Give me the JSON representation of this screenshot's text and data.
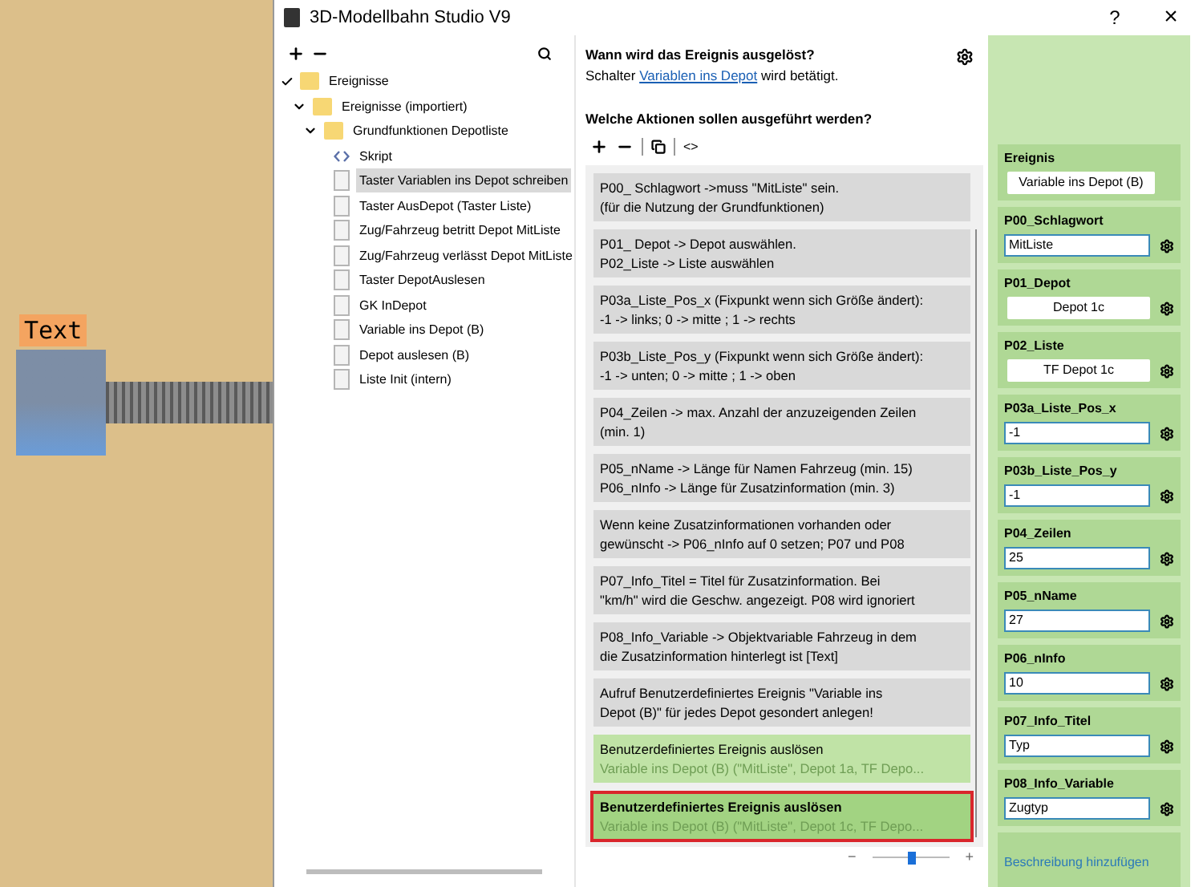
{
  "canvas": {
    "label": "Text"
  },
  "window": {
    "title": "3D-Modellbahn Studio V9",
    "help": "?",
    "close": "×"
  },
  "tree": {
    "items": [
      {
        "label": "Ereignisse",
        "kind": "folder",
        "expanded": true,
        "selected": false,
        "children": [
          {
            "label": "Ereignisse (importiert)",
            "kind": "folder",
            "expanded": true,
            "selected": false,
            "children": [
              {
                "label": "Grundfunktionen Depotliste",
                "kind": "folder",
                "expanded": true,
                "selected": false,
                "children": [
                  {
                    "label": "Skript",
                    "kind": "script",
                    "selected": false
                  },
                  {
                    "label": "Taster Variablen ins Depot schreiben",
                    "kind": "page",
                    "selected": true
                  },
                  {
                    "label": "Taster AusDepot (Taster Liste)",
                    "kind": "page",
                    "selected": false
                  },
                  {
                    "label": "Zug/Fahrzeug betritt Depot MitListe",
                    "kind": "page",
                    "selected": false
                  },
                  {
                    "label": "Zug/Fahrzeug verlässt Depot MitListe",
                    "kind": "page",
                    "selected": false
                  },
                  {
                    "label": "Taster DepotAuslesen",
                    "kind": "page",
                    "selected": false
                  },
                  {
                    "label": "GK InDepot",
                    "kind": "page",
                    "selected": false
                  },
                  {
                    "label": "Variable ins Depot (B)",
                    "kind": "page",
                    "selected": false
                  },
                  {
                    "label": "Depot auslesen (B)",
                    "kind": "page",
                    "selected": false
                  },
                  {
                    "label": "Liste Init (intern)",
                    "kind": "page",
                    "selected": false
                  }
                ]
              }
            ]
          }
        ]
      }
    ]
  },
  "trigger": {
    "heading": "Wann wird das Ereignis ausgelöst?",
    "text_before": "Schalter",
    "link": "Variablen ins Depot",
    "text_after": "wird betätigt."
  },
  "actions_heading": "Welche Aktionen sollen ausgeführt werden?",
  "toolbar": {
    "code": "<>"
  },
  "actions": [
    {
      "kind": "comment",
      "lines": [
        "P00_ Schlagwort ->muss \"MitListe\" sein.",
        "(für die Nutzung der Grundfunktionen)"
      ]
    },
    {
      "kind": "comment",
      "lines": [
        "P01_ Depot -> Depot auswählen.",
        "P02_Liste -> Liste auswählen"
      ]
    },
    {
      "kind": "comment",
      "lines": [
        "P03a_Liste_Pos_x (Fixpunkt wenn sich Größe ändert):",
        "-1 -> links;  0 -> mitte ; 1 -> rechts"
      ]
    },
    {
      "kind": "comment",
      "lines": [
        "P03b_Liste_Pos_y (Fixpunkt wenn sich Größe ändert):",
        "-1 -> unten;  0 -> mitte ; 1 -> oben"
      ]
    },
    {
      "kind": "comment",
      "lines": [
        "P04_Zeilen -> max. Anzahl der anzuzeigenden Zeilen",
        "(min. 1)"
      ]
    },
    {
      "kind": "comment",
      "lines": [
        "P05_nName -> Länge für Namen Fahrzeug (min. 15)",
        "P06_nInfo -> Länge für Zusatzinformation (min. 3)"
      ]
    },
    {
      "kind": "comment",
      "lines": [
        "Wenn keine Zusatzinformationen vorhanden oder",
        "gewünscht -> P06_nInfo auf 0 setzen; P07 und P08"
      ]
    },
    {
      "kind": "comment",
      "lines": [
        "P07_Info_Titel = Titel für Zusatzinformation. Bei",
        "\"km/h\" wird die Geschw. angezeigt. P08 wird ignoriert"
      ]
    },
    {
      "kind": "comment",
      "lines": [
        "P08_Info_Variable  -> Objektvariable Fahrzeug in dem",
        "die Zusatzinformation hinterlegt ist [Text]"
      ]
    },
    {
      "kind": "comment",
      "lines": [
        "Aufruf Benutzerdefiniertes Ereignis \"Variable ins",
        "Depot (B)\" für jedes Depot gesondert anlegen!"
      ]
    },
    {
      "kind": "event",
      "selected": false,
      "title": "Benutzerdefiniertes Ereignis auslösen",
      "detail": "Variable ins Depot (B) (\"MitListe\", Depot 1a, TF Depo..."
    },
    {
      "kind": "event",
      "selected": true,
      "title": "Benutzerdefiniertes Ereignis auslösen",
      "detail": "Variable ins Depot (B) (\"MitListe\", Depot 1c, TF Depo..."
    }
  ],
  "zoom": {
    "minus": "−",
    "plus": "+",
    "level": 0.5
  },
  "params": [
    {
      "label": "Ereignis",
      "kind": "event",
      "value": "Variable ins Depot (B)"
    },
    {
      "label": "P00_Schlagwort",
      "kind": "input",
      "value": "MitListe"
    },
    {
      "label": "P01_Depot",
      "kind": "button",
      "value": "Depot 1c"
    },
    {
      "label": "P02_Liste",
      "kind": "button",
      "value": "TF Depot 1c"
    },
    {
      "label": "P03a_Liste_Pos_x",
      "kind": "input",
      "value": "-1"
    },
    {
      "label": "P03b_Liste_Pos_y",
      "kind": "input",
      "value": "-1"
    },
    {
      "label": "P04_Zeilen",
      "kind": "input",
      "value": "25"
    },
    {
      "label": "P05_nName",
      "kind": "input",
      "value": "27"
    },
    {
      "label": "P06_nInfo",
      "kind": "input",
      "value": "10"
    },
    {
      "label": "P07_Info_Titel",
      "kind": "input",
      "value": "Typ"
    },
    {
      "label": "P08_Info_Variable",
      "kind": "input",
      "value": "Zugtyp"
    }
  ],
  "add_description": "Beschreibung hinzufügen"
}
